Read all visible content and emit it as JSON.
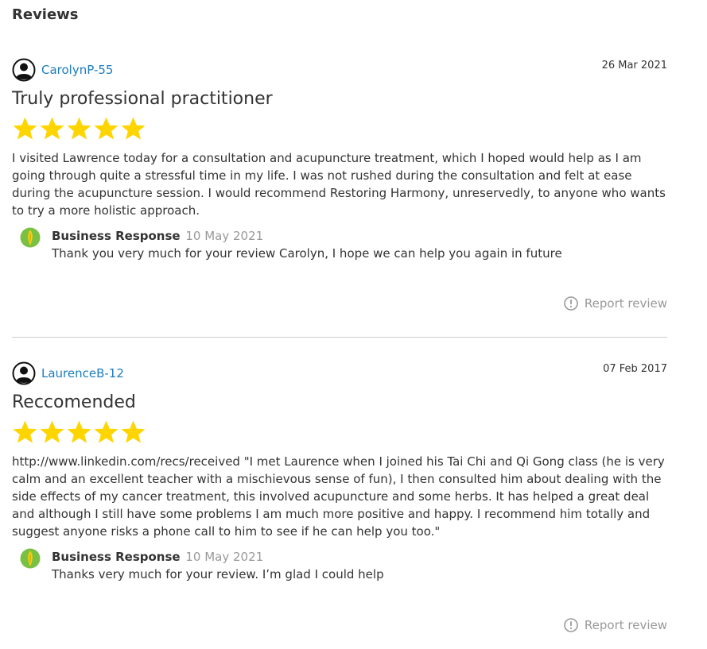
{
  "section": {
    "title": "Reviews"
  },
  "colors": {
    "star": "#FFD500",
    "username": "#1a7dbd",
    "muted": "#999999",
    "logo_green": "#7ac143",
    "logo_yellow": "#f7d117"
  },
  "reviews": [
    {
      "username": "CarolynP-55",
      "date": "26 Mar 2021",
      "title": "Truly professional practitioner",
      "rating": 5,
      "body": "I visited Lawrence today for a consultation and acupuncture treatment, which I hoped would help as I am going through quite a stressful time in my life. I was not rushed during the consultation and felt at ease during the acupuncture session. I would recommend Restoring Harmony, unreservedly, to anyone who wants to try a more holistic approach.",
      "response": {
        "label": "Business Response",
        "date": "10 May 2021",
        "text": "Thank you very much for your review Carolyn, I hope we can help you again in future"
      },
      "report_label": "Report review"
    },
    {
      "username": "LaurenceB-12",
      "date": "07 Feb 2017",
      "title": "Reccomended",
      "rating": 5,
      "body": "http://www.linkedin.com/recs/received \"I met Laurence when I joined his Tai Chi and Qi Gong class (he is very calm and an excellent teacher with a mischievous sense of fun), I then consulted him about dealing with the side effects of my cancer treatment, this involved acupuncture and some herbs. It has helped a great deal and although I still have some problems I am much more positive and happy. I recommend him totally and suggest anyone risks a phone call to him to see if he can help you too.\"",
      "response": {
        "label": "Business Response",
        "date": "10 May 2021",
        "text": "Thanks very much for your review. I’m glad I could help"
      },
      "report_label": "Report review"
    }
  ],
  "icons": {
    "avatar": "user-avatar-icon",
    "star": "star-icon",
    "business_logo": "business-logo-icon",
    "report": "exclamation-circle-icon"
  }
}
